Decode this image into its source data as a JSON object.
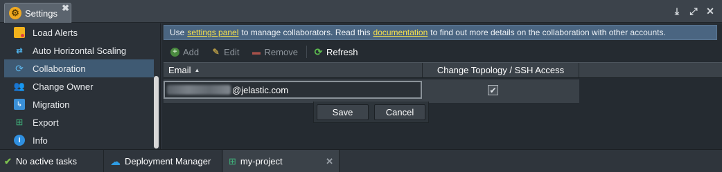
{
  "window": {
    "tab_title": "Settings",
    "tab_close": "✖",
    "icons": [
      "download-icon",
      "expand-icon",
      "close-icon"
    ]
  },
  "sidebar": {
    "items": [
      {
        "label": "Load Alerts",
        "icon": "load-alerts-icon",
        "active": false
      },
      {
        "label": "Auto Horizontal Scaling",
        "icon": "scaling-icon",
        "active": false
      },
      {
        "label": "Collaboration",
        "icon": "collaboration-icon",
        "active": true
      },
      {
        "label": "Change Owner",
        "icon": "change-owner-icon",
        "active": false
      },
      {
        "label": "Migration",
        "icon": "migration-icon",
        "active": false
      },
      {
        "label": "Export",
        "icon": "export-icon",
        "active": false
      },
      {
        "label": "Info",
        "icon": "info-icon",
        "active": false
      }
    ]
  },
  "info_bar": {
    "text_1": "Use",
    "link_1": "settings panel",
    "text_2": "to manage collaborators. Read this",
    "link_2": "documentation",
    "text_3": "to find out more details on the collaboration with other accounts."
  },
  "toolbar": {
    "add": "Add",
    "edit": "Edit",
    "remove": "Remove",
    "refresh": "Refresh"
  },
  "grid": {
    "columns": [
      "Email",
      "Change Topology / SSH Access"
    ],
    "sort_indicator": "▲",
    "row": {
      "email_suffix": "@jelastic.com",
      "topology_checked": true
    }
  },
  "edit_panel": {
    "save": "Save",
    "cancel": "Cancel"
  },
  "taskbar": {
    "status": "No active tasks",
    "deployment_manager": "Deployment Manager",
    "project": "my-project"
  },
  "colors": {
    "accent_link": "#f6e04b",
    "active_item": "#3f5a73",
    "info_bar": "#4a6581"
  }
}
